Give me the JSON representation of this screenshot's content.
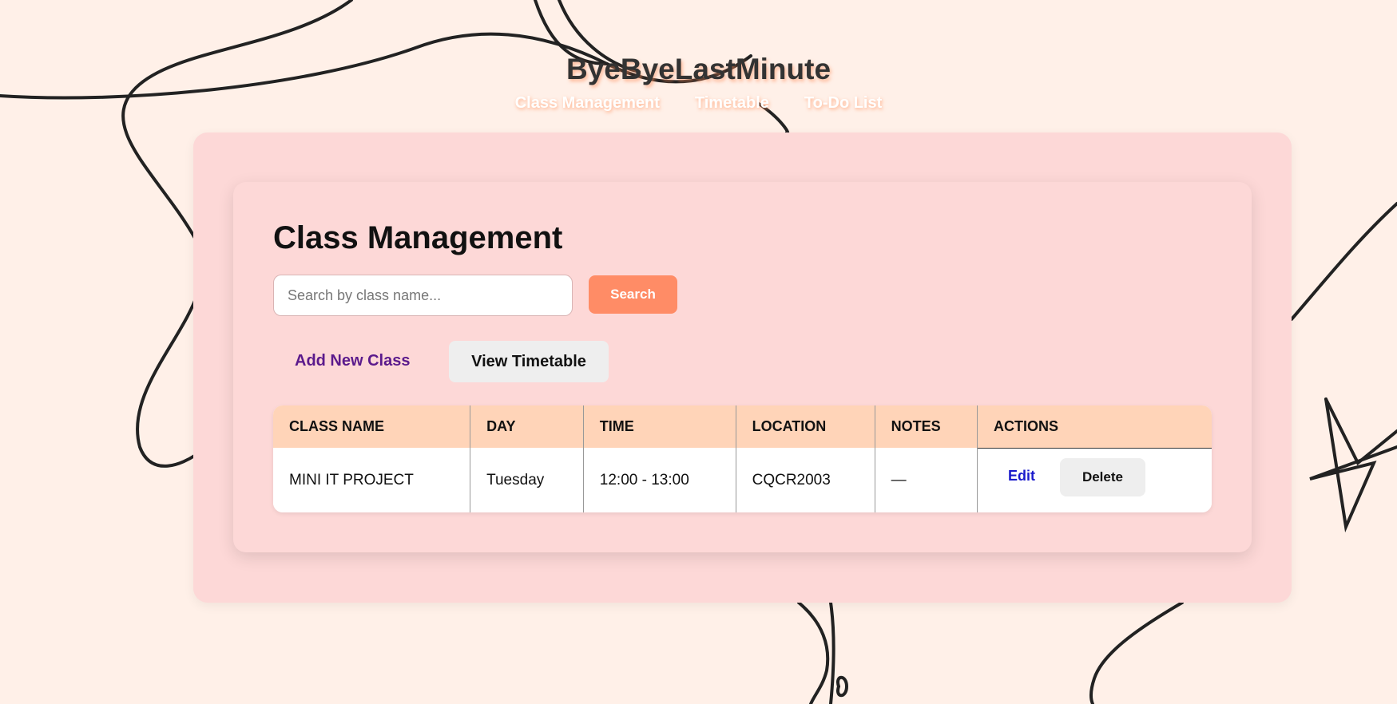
{
  "site": {
    "title": "ByeByeLastMinute",
    "nav": [
      "Class Management",
      "Timetable",
      "To-Do List"
    ]
  },
  "page": {
    "title": "Class Management",
    "search": {
      "placeholder": "Search by class name...",
      "value": "",
      "button_label": "Search"
    },
    "add_link_label": "Add New Class",
    "view_timetable_label": "View Timetable"
  },
  "table": {
    "headers": [
      "CLASS NAME",
      "DAY",
      "TIME",
      "LOCATION",
      "NOTES",
      "ACTIONS"
    ],
    "rows": [
      {
        "class_name": "MINI IT PROJECT",
        "day": "Tuesday",
        "time": "12:00 - 13:00",
        "location": "CQCR2003",
        "notes": "—",
        "edit_label": "Edit",
        "delete_label": "Delete"
      }
    ]
  },
  "colors": {
    "background": "#fff0e8",
    "panel": "#fdd8d7",
    "header_row": "#ffd4b8",
    "accent": "#ff8c66",
    "link": "#5b1a8c",
    "edit_link": "#1a1acc"
  }
}
